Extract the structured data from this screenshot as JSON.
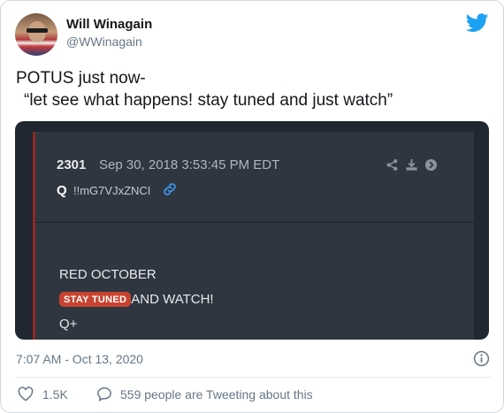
{
  "author": {
    "name": "Will Winagain",
    "handle": "@WWinagain"
  },
  "tweet": {
    "line1": "POTUS just now-",
    "line2": "“let see what happens! stay tuned and just watch”"
  },
  "embed": {
    "post_number": "2301",
    "post_date": "Sep 30, 2018 3:53:45 PM EDT",
    "trip_q": "Q",
    "tripcode": "!!mG7VJxZNCI",
    "body_line1": "RED OCTOBER",
    "badge": "STAY TUNED",
    "body_line2_rest": "AND WATCH!",
    "body_line3": "Q+"
  },
  "footer": {
    "timestamp": "7:07 AM - Oct 13, 2020",
    "like_count": "1.5K",
    "reply_text": "559 people are Tweeting about this"
  },
  "colors": {
    "twitter_blue": "#1da1f2",
    "badge_red": "#c8432f",
    "embed_bg": "#2f3640"
  },
  "icons": [
    "twitter-bird-icon",
    "link-icon",
    "share-icon",
    "download-icon",
    "go-icon",
    "info-icon",
    "heart-icon",
    "reply-icon"
  ]
}
